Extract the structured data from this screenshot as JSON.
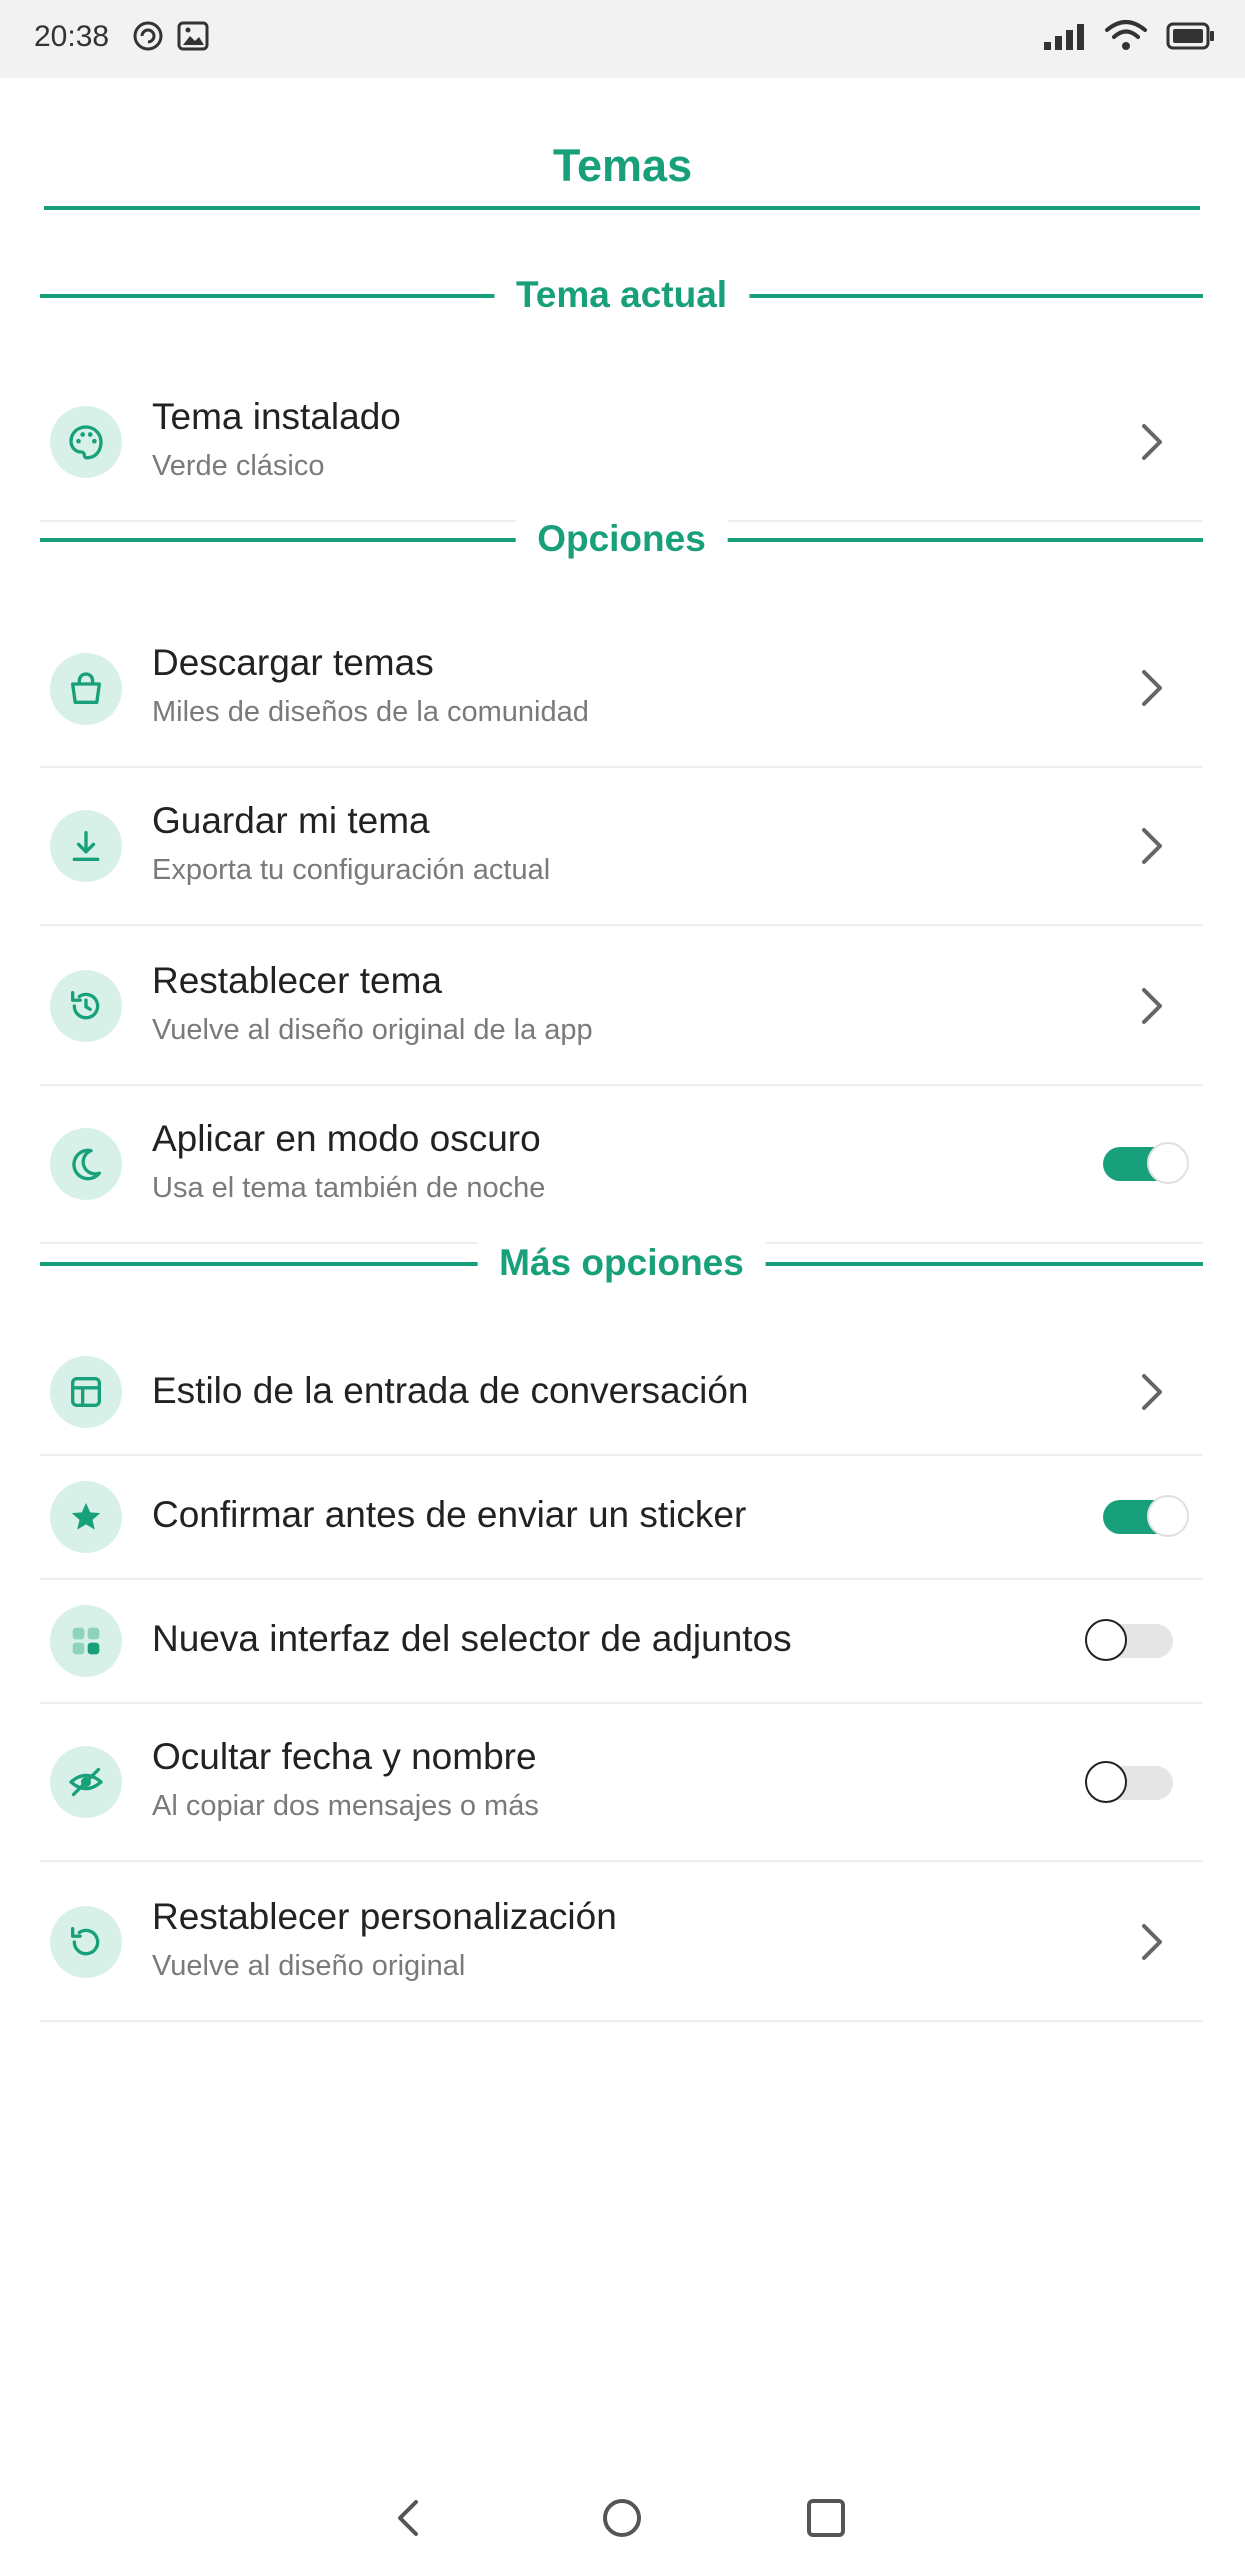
{
  "status_bar": {
    "time": "20:38",
    "icons": [
      "sync-icon",
      "image-icon",
      "signal-icon",
      "wifi-icon",
      "battery-icon"
    ]
  },
  "header": {
    "title": "Temas"
  },
  "sections": {
    "current": "Tema actual",
    "options": "Opciones",
    "more": "Más opciones"
  },
  "current_theme": {
    "title": "Tema instalado",
    "subtitle": "Verde clásico",
    "icon": "palette-icon"
  },
  "options": [
    {
      "title": "Descargar temas",
      "subtitle": "Miles de diseños de la comunidad",
      "icon": "shopping-bag-icon"
    },
    {
      "title": "Guardar mi tema",
      "subtitle": "Exporta tu configuración actual",
      "icon": "download-icon"
    },
    {
      "title": "Restablecer tema",
      "subtitle": "Vuelve al diseño original de la app",
      "icon": "reset-icon"
    },
    {
      "title": "Aplicar en modo oscuro",
      "subtitle": "Usa el tema también de noche",
      "icon": "moon-icon",
      "toggle": true
    }
  ],
  "more_options": [
    {
      "title": "Estilo de la entrada de conversación",
      "icon": "layout-icon"
    },
    {
      "title": "Confirmar antes de enviar un sticker",
      "icon": "star-icon",
      "toggle": true
    },
    {
      "title": "Nueva interfaz del selector de adjuntos",
      "icon": "grid-icon",
      "toggle": false
    },
    {
      "title": "Ocultar fecha y nombre",
      "subtitle": "Al copiar dos mensajes o más",
      "icon": "eye-off-icon",
      "toggle": false
    },
    {
      "title": "Restablecer personalización",
      "subtitle": "Vuelve al diseño original",
      "icon": "reset-icon"
    }
  ],
  "colors": {
    "accent": "#18a07a",
    "icon_bg": "#d7f1e8",
    "toggle_off": "#e5e5e5"
  },
  "nav_bar": {
    "icons": [
      "back-icon",
      "home-icon",
      "recents-icon"
    ]
  }
}
